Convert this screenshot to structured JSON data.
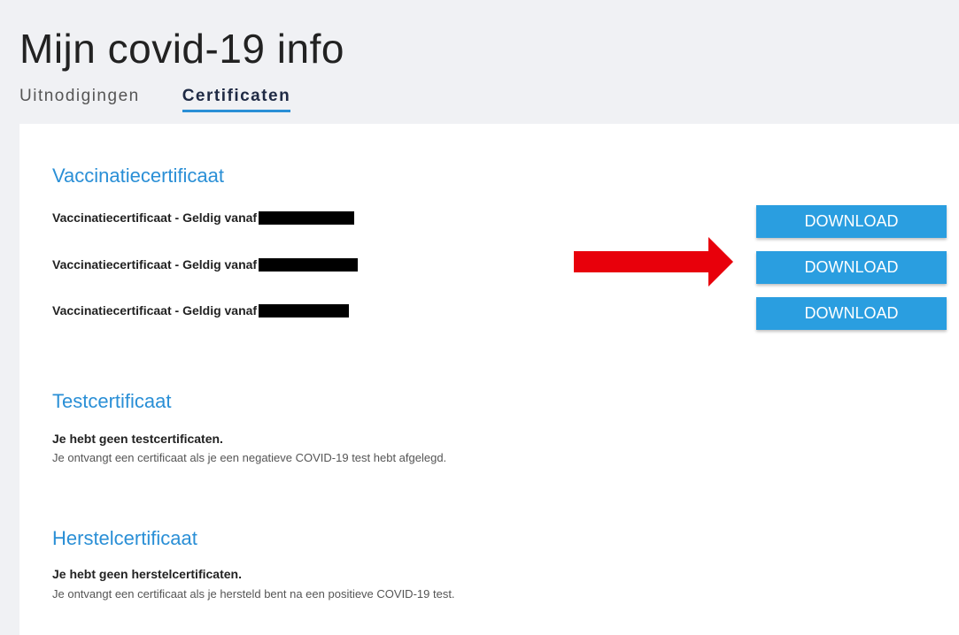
{
  "header": {
    "title": "Mijn covid-19 info",
    "tabs": [
      {
        "label": "Uitnodigingen",
        "active": false
      },
      {
        "label": "Certificaten",
        "active": true
      }
    ]
  },
  "vaccination": {
    "title": "Vaccinatiecertificaat",
    "rows": [
      {
        "label": "Vaccinatiecertificaat - Geldig vanaf",
        "date": "[redacted]",
        "button": "DOWNLOAD"
      },
      {
        "label": "Vaccinatiecertificaat - Geldig vanaf",
        "date": "[redacted]",
        "button": "DOWNLOAD"
      },
      {
        "label": "Vaccinatiecertificaat - Geldig vanaf",
        "date": "[redacted]",
        "button": "DOWNLOAD"
      }
    ]
  },
  "test": {
    "title": "Testcertificaat",
    "empty_title": "Je hebt geen testcertificaten.",
    "empty_desc": "Je ontvangt een certificaat als je een negatieve COVID-19 test hebt afgelegd."
  },
  "recovery": {
    "title": "Herstelcertificaat",
    "empty_title": "Je hebt geen herstelcertificaten.",
    "empty_desc": "Je ontvangt een certificaat als je hersteld bent na een positieve COVID-19 test."
  },
  "colors": {
    "accent": "#2a8fd6",
    "button": "#2a9ee0",
    "annotation_arrow": "#e8000b",
    "header_background": "#f0f1f4"
  },
  "icons": {
    "annotation": "right-arrow-icon"
  }
}
